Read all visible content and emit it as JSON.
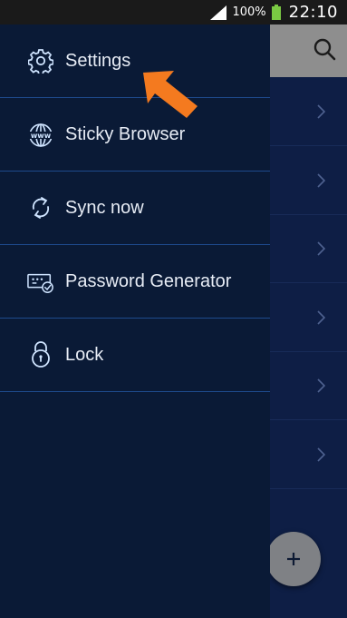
{
  "status_bar": {
    "battery_text": "100%",
    "time": "22:10"
  },
  "drawer": {
    "items": [
      {
        "label": "Settings",
        "icon": "gear-icon"
      },
      {
        "label": "Sticky Browser",
        "icon": "www-globe-icon"
      },
      {
        "label": "Sync now",
        "icon": "sync-icon"
      },
      {
        "label": "Password Generator",
        "icon": "password-generator-icon"
      },
      {
        "label": "Lock",
        "icon": "lock-icon"
      }
    ]
  },
  "colors": {
    "drawer_bg": "#0a1a36",
    "divider": "#1e4a8c",
    "accent_arrow": "#f47a1f",
    "fab": "#7f8185"
  }
}
